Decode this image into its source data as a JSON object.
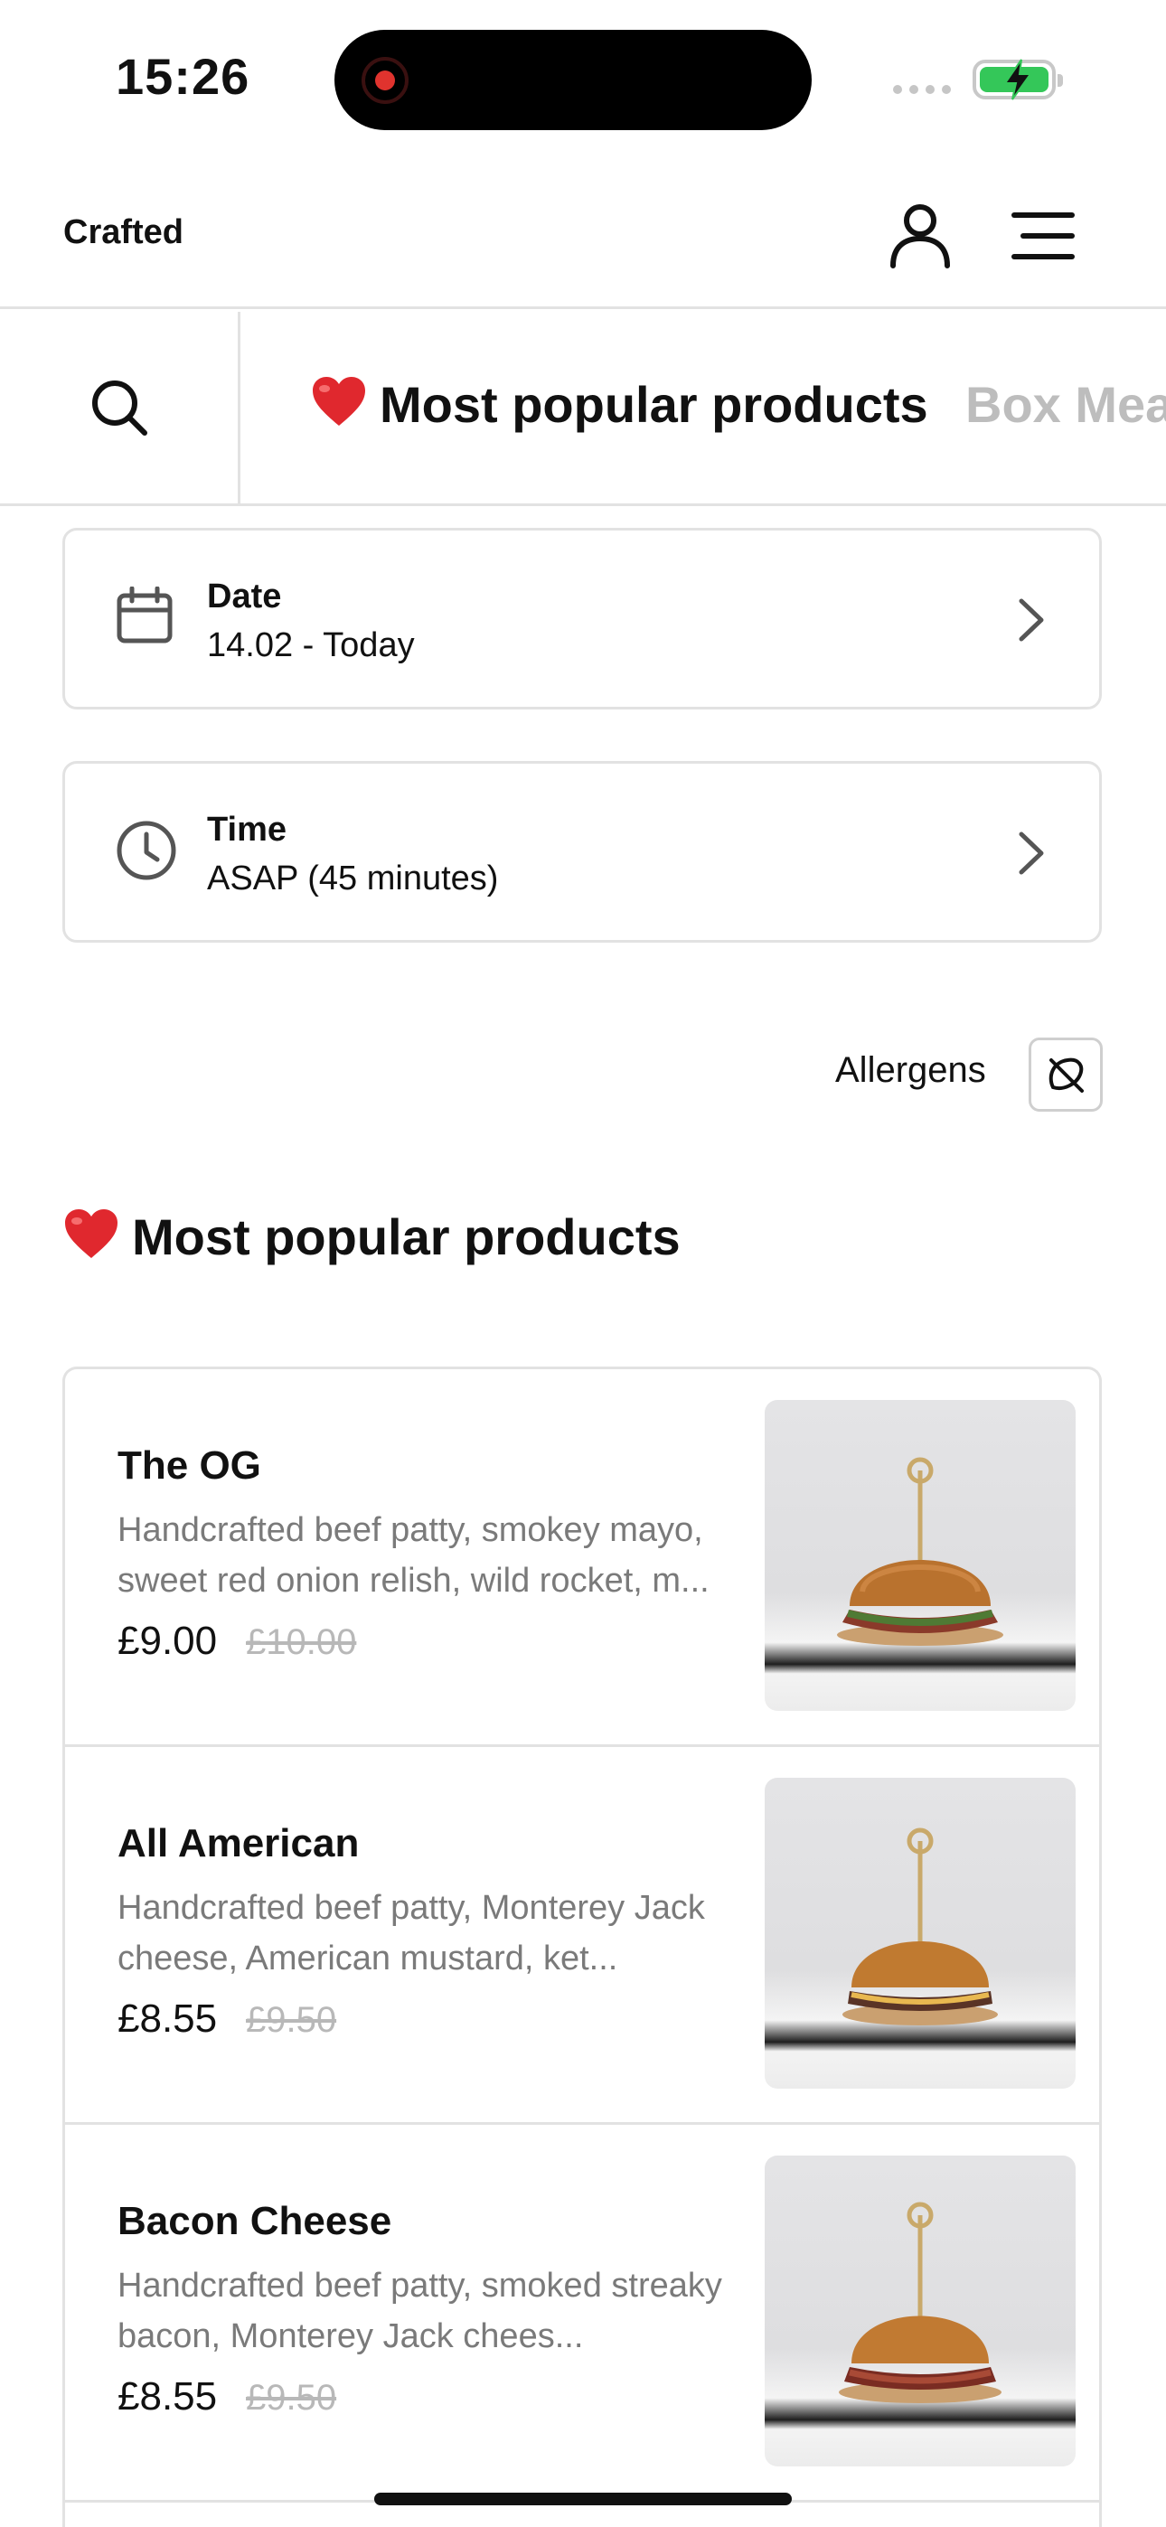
{
  "status_bar": {
    "time": "15:26"
  },
  "header": {
    "brand": "Crafted",
    "icons": [
      "user-icon",
      "menu-icon"
    ]
  },
  "category_bar": {
    "tabs": [
      {
        "label": "Most popular products",
        "emoji": "heart-icon",
        "active": true
      },
      {
        "label": "Box Mea",
        "active": false
      }
    ]
  },
  "date_selector": {
    "title": "Date",
    "value": "14.02 - Today"
  },
  "time_selector": {
    "title": "Time",
    "value": "ASAP (45 minutes)"
  },
  "allergens": {
    "label": "Allergens"
  },
  "section": {
    "title": "Most popular products"
  },
  "products": [
    {
      "name": "The OG",
      "description": "Handcrafted beef patty, smokey mayo, sweet red onion relish, wild rocket, m...",
      "price": "£9.00",
      "old_price": "£10.00"
    },
    {
      "name": "All American",
      "description": "Handcrafted beef patty, Monterey Jack cheese, American mustard, ket...",
      "price": "£8.55",
      "old_price": "£9.50"
    },
    {
      "name": "Bacon Cheese",
      "description": "Handcrafted beef patty, smoked streaky bacon, Monterey Jack chees...",
      "price": "£8.55",
      "old_price": "£9.50"
    }
  ],
  "colors": {
    "accent_heart": "#e0282e",
    "border": "#e2e2e2",
    "muted_text": "#7a7a7a",
    "strike_price": "#b8b8b8",
    "battery": "#34c759"
  }
}
